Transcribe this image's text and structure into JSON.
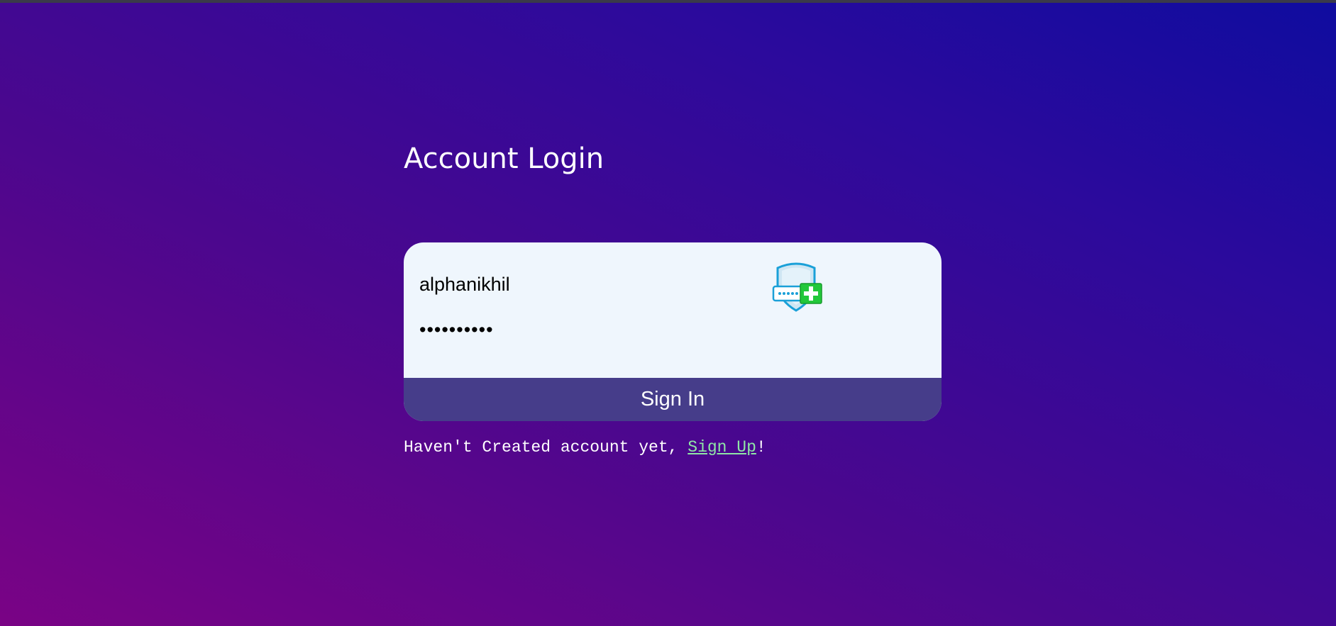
{
  "page": {
    "title": "Account Login",
    "background_colors": [
      "#7a0385",
      "#4b078e",
      "#2b0a9c",
      "#0f0c9f"
    ]
  },
  "login_form": {
    "username_value": "alphanikhil",
    "password_value": "••••••••••",
    "password_manager_icon": "password-shield-plus-icon",
    "sign_in_label": "Sign In",
    "card_color": "#eff6fd",
    "button_color": "#463d8a"
  },
  "signup_prompt": {
    "text_before": "Haven't Created account yet, ",
    "link_label": "Sign Up",
    "text_after": "!",
    "link_color": "#8fe6a6"
  }
}
